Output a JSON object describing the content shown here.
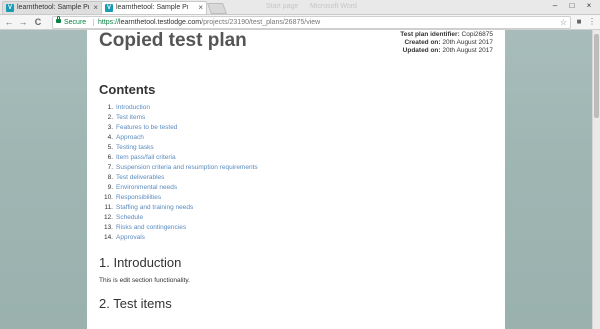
{
  "tabs": [
    {
      "title": "learnthetool: Sample Pro",
      "close": "×"
    },
    {
      "title": "learnthetool: Sample Pro",
      "close": "×"
    }
  ],
  "ghost_tabs": [
    "Start page",
    "Microsoft Word"
  ],
  "window_controls": [
    "–",
    "□",
    "×"
  ],
  "toolbar": {
    "back": "←",
    "forward": "→",
    "reload": "C",
    "secure_label": "Secure",
    "url_scheme": "https://",
    "url_host": "learnthetool.testlodge.com",
    "url_path": "/projects/23190/test_plans/26875/view",
    "star": "☆"
  },
  "extensions": [
    "■",
    "⋮"
  ],
  "document": {
    "title": "Copied test plan",
    "meta": {
      "identifier_label": "Test plan identifier:",
      "identifier_value": "Copi26875",
      "created_label": "Created on:",
      "created_value": "20th August 2017",
      "updated_label": "Updated on:",
      "updated_value": "20th August 2017"
    },
    "contents_heading": "Contents",
    "toc": [
      {
        "num": "1.",
        "label": "Introduction"
      },
      {
        "num": "2.",
        "label": "Test items"
      },
      {
        "num": "3.",
        "label": "Features to be tested"
      },
      {
        "num": "4.",
        "label": "Approach"
      },
      {
        "num": "5.",
        "label": "Testing tasks"
      },
      {
        "num": "6.",
        "label": "Item pass/fail criteria"
      },
      {
        "num": "7.",
        "label": "Suspension criteria and resumption requirements"
      },
      {
        "num": "8.",
        "label": "Test deliverables"
      },
      {
        "num": "9.",
        "label": "Environmental needs"
      },
      {
        "num": "10.",
        "label": "Responsibilities"
      },
      {
        "num": "11.",
        "label": "Staffing and training needs"
      },
      {
        "num": "12.",
        "label": "Schedule"
      },
      {
        "num": "13.",
        "label": "Risks and contingencies"
      },
      {
        "num": "14.",
        "label": "Approvals"
      }
    ],
    "section1_heading": "1. Introduction",
    "section1_text": "This is edit section functionality.",
    "section2_heading": "2. Test items"
  }
}
